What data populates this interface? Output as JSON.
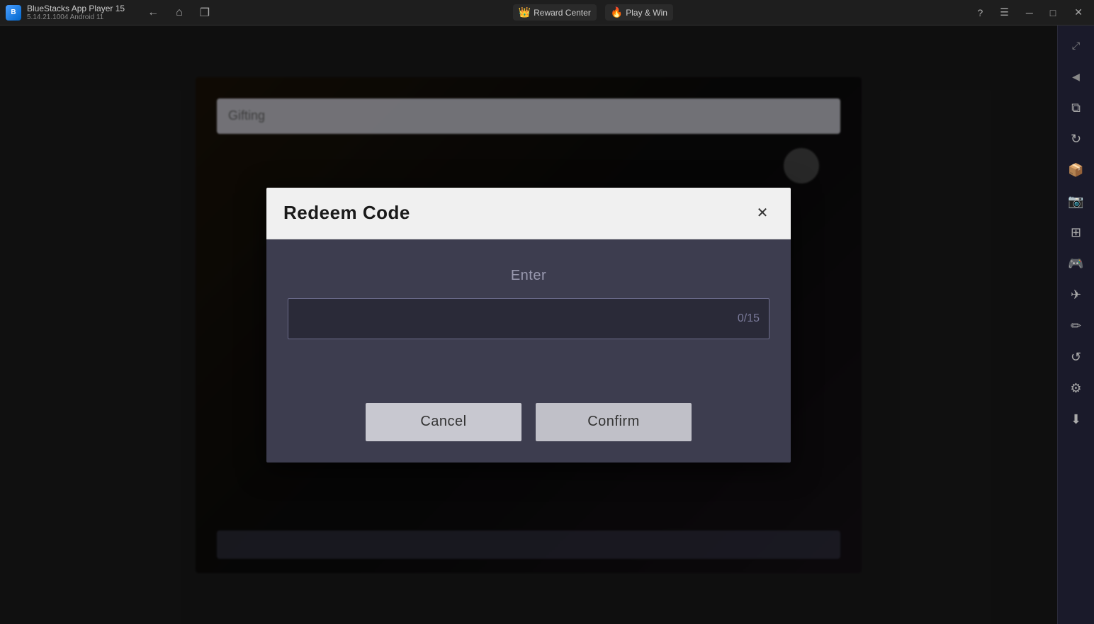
{
  "titlebar": {
    "app_name": "BlueStacks App Player 15",
    "version": "5.14.21.1004  Android 11",
    "reward_center_label": "Reward Center",
    "play_win_label": "Play & Win"
  },
  "sidebar": {
    "icons": [
      {
        "name": "expand-icon",
        "glyph": "⤢"
      },
      {
        "name": "sidebar-arrow-icon",
        "glyph": "◀"
      },
      {
        "name": "layer-icon",
        "glyph": "⧉"
      },
      {
        "name": "rotate-icon",
        "glyph": "↻"
      },
      {
        "name": "apk-icon",
        "glyph": "📦"
      },
      {
        "name": "screenshot-icon",
        "glyph": "📷"
      },
      {
        "name": "resize-icon",
        "glyph": "⊞"
      },
      {
        "name": "gamepad-icon",
        "glyph": "🎮"
      },
      {
        "name": "plane-icon",
        "glyph": "✈"
      },
      {
        "name": "brush-icon",
        "glyph": "✏"
      },
      {
        "name": "refresh-icon",
        "glyph": "↺"
      },
      {
        "name": "gear-icon",
        "glyph": "⚙"
      },
      {
        "name": "download-icon",
        "glyph": "⬇"
      }
    ]
  },
  "dialog": {
    "title": "Redeem Code",
    "close_label": "✕",
    "enter_label": "Enter",
    "input_placeholder": "",
    "input_counter": "0/15",
    "cancel_label": "Cancel",
    "confirm_label": "Confirm"
  }
}
